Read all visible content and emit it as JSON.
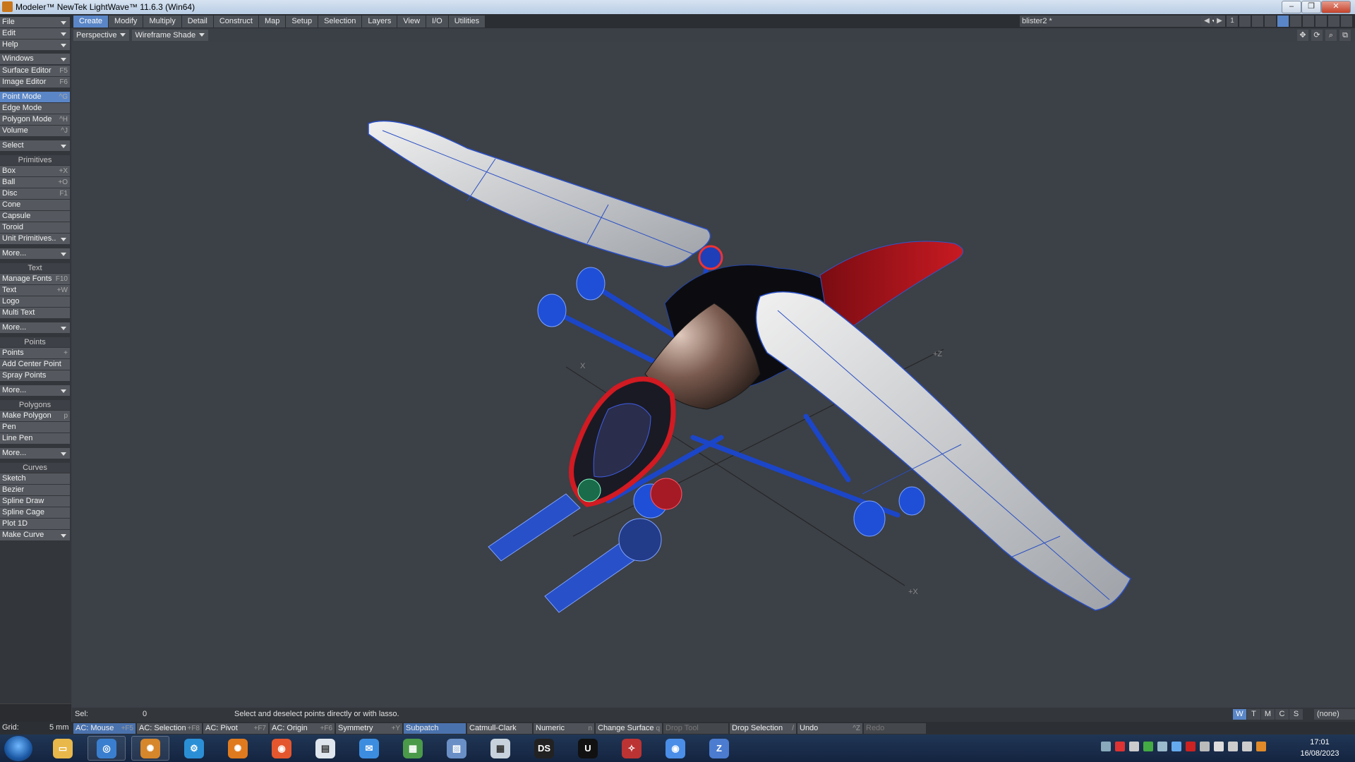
{
  "window": {
    "title": "Modeler™ NewTek LightWave™ 11.6.3 (Win64)"
  },
  "menu": {
    "file": "File",
    "edit": "Edit",
    "help": "Help",
    "tabs": [
      "Create",
      "Modify",
      "Multiply",
      "Detail",
      "Construct",
      "Map",
      "Setup",
      "Selection",
      "Layers",
      "View",
      "I/O",
      "Utilities"
    ],
    "active_tab": "Create",
    "object_name": "blister2 *",
    "layer_number": "1"
  },
  "viewport": {
    "projection": "Perspective",
    "render_mode": "Wireframe Shade",
    "axis_labels": [
      "X",
      "+Z",
      "+X"
    ]
  },
  "sidebar": {
    "windows": "Windows",
    "editors": [
      {
        "label": "Surface Editor",
        "shortcut": "F5"
      },
      {
        "label": "Image Editor",
        "shortcut": "F6"
      }
    ],
    "modes": [
      {
        "label": "Point Mode",
        "shortcut": "^G",
        "active": true
      },
      {
        "label": "Edge Mode",
        "shortcut": ""
      },
      {
        "label": "Polygon Mode",
        "shortcut": "^H"
      },
      {
        "label": "Volume",
        "shortcut": "^J"
      }
    ],
    "select": "Select",
    "primitives_title": "Primitives",
    "primitives": [
      {
        "label": "Box",
        "shortcut": "+X"
      },
      {
        "label": "Ball",
        "shortcut": "+O"
      },
      {
        "label": "Disc",
        "shortcut": "F1"
      },
      {
        "label": "Cone",
        "shortcut": ""
      },
      {
        "label": "Capsule",
        "shortcut": ""
      },
      {
        "label": "Toroid",
        "shortcut": ""
      },
      {
        "label": "Unit Primitives..",
        "shortcut": ""
      }
    ],
    "more": "More...",
    "text_title": "Text",
    "text_items": [
      {
        "label": "Manage Fonts",
        "shortcut": "F10"
      },
      {
        "label": "Text",
        "shortcut": "+W"
      },
      {
        "label": "Logo",
        "shortcut": ""
      },
      {
        "label": "Multi Text",
        "shortcut": ""
      }
    ],
    "points_title": "Points",
    "points_items": [
      {
        "label": "Points",
        "shortcut": "+"
      },
      {
        "label": "Add Center Point",
        "shortcut": ""
      },
      {
        "label": "Spray Points",
        "shortcut": ""
      }
    ],
    "polygons_title": "Polygons",
    "polygons_items": [
      {
        "label": "Make Polygon",
        "shortcut": "p"
      },
      {
        "label": "Pen",
        "shortcut": ""
      },
      {
        "label": "Line Pen",
        "shortcut": ""
      }
    ],
    "curves_title": "Curves",
    "curves_items": [
      {
        "label": "Sketch",
        "shortcut": ""
      },
      {
        "label": "Bezier",
        "shortcut": ""
      },
      {
        "label": "Spline Draw",
        "shortcut": ""
      },
      {
        "label": "Spline Cage",
        "shortcut": ""
      },
      {
        "label": "Plot 1D",
        "shortcut": ""
      }
    ],
    "make_curve": "Make Curve"
  },
  "status": {
    "sel_label": "Sel:",
    "sel_value": "0",
    "message": "Select and deselect points directly or with lasso.",
    "view_buttons": [
      "W",
      "T",
      "M",
      "C",
      "S"
    ],
    "view_buttons_active": "W",
    "dropdown": "(none)"
  },
  "bottom": {
    "grid_label": "Grid:",
    "grid_value": "5 mm",
    "buttons": [
      {
        "label": "AC: Mouse",
        "shortcut": "+F5",
        "state": "active"
      },
      {
        "label": "AC: Selection",
        "shortcut": "+F8",
        "state": "normal"
      },
      {
        "label": "AC: Pivot",
        "shortcut": "+F7",
        "state": "normal"
      },
      {
        "label": "AC: Origin",
        "shortcut": "+F6",
        "state": "normal"
      },
      {
        "label": "Symmetry",
        "shortcut": "+Y",
        "state": "normal"
      },
      {
        "label": "Subpatch",
        "shortcut": "",
        "state": "active"
      },
      {
        "label": "Catmull-Clark",
        "shortcut": "",
        "state": "normal"
      },
      {
        "label": "Numeric",
        "shortcut": "n",
        "state": "normal"
      },
      {
        "label": "Change Surface",
        "shortcut": "q",
        "state": "normal"
      },
      {
        "label": "Drop Tool",
        "shortcut": "",
        "state": "dim"
      },
      {
        "label": "Drop Selection",
        "shortcut": "/",
        "state": "normal"
      },
      {
        "label": "Undo",
        "shortcut": "^Z",
        "state": "normal"
      },
      {
        "label": "Redo",
        "shortcut": "",
        "state": "dim"
      }
    ]
  },
  "taskbar": {
    "apps": [
      {
        "name": "explorer",
        "color": "#e8b84a",
        "glyph": "▭"
      },
      {
        "name": "lightwave-layout",
        "color": "#3a7fcf",
        "glyph": "◎"
      },
      {
        "name": "lightwave-modeler",
        "color": "#d6862b",
        "glyph": "✺"
      },
      {
        "name": "hub",
        "color": "#2b8fd6",
        "glyph": "⚙"
      },
      {
        "name": "blender-like",
        "color": "#e07a1e",
        "glyph": "✺"
      },
      {
        "name": "firefox",
        "color": "#e4572e",
        "glyph": "◉"
      },
      {
        "name": "notepad",
        "color": "#dfe6ee",
        "glyph": "▤"
      },
      {
        "name": "thunderbird",
        "color": "#3c8de0",
        "glyph": "✉"
      },
      {
        "name": "monitor",
        "color": "#4a9a4a",
        "glyph": "▦"
      },
      {
        "name": "pictures",
        "color": "#6a8fc6",
        "glyph": "▨"
      },
      {
        "name": "calculator",
        "color": "#c8d2dc",
        "glyph": "▦"
      },
      {
        "name": "daz-studio",
        "color": "#222222",
        "glyph": "DS"
      },
      {
        "name": "unreal",
        "color": "#111111",
        "glyph": "U"
      },
      {
        "name": "davinci",
        "color": "#b33",
        "glyph": "✧"
      },
      {
        "name": "chrome",
        "color": "#4a8ee8",
        "glyph": "◉"
      },
      {
        "name": "terminal",
        "color": "#4b7cd0",
        "glyph": "Z"
      }
    ],
    "time": "17:01",
    "date": "16/08/2023"
  }
}
